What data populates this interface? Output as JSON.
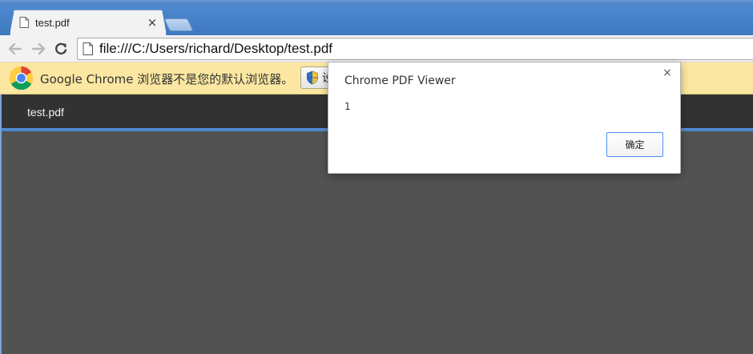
{
  "tab": {
    "title": "test.pdf",
    "close_glyph": "×",
    "icon": "page-icon"
  },
  "toolbar": {
    "back_icon": "back-arrow-icon",
    "forward_icon": "forward-arrow-icon",
    "reload_icon": "reload-icon",
    "url": "file:///C:/Users/richard/Desktop/test.pdf"
  },
  "infobar": {
    "logo_icon": "chrome-logo-icon",
    "message": "Google Chrome 浏览器不是您的默认浏览器。",
    "button_label": "设"
  },
  "pdf_viewer": {
    "title": "test.pdf"
  },
  "dialog": {
    "title": "Chrome PDF Viewer",
    "message": "1",
    "close_glyph": "×",
    "ok_label": "确定"
  },
  "colors": {
    "tab_strip": "#4a86c8",
    "infobar_bg": "#fbe7a1",
    "pdf_toolbar": "#323232",
    "pdf_canvas": "#525252",
    "focus_blue": "#4d90fe"
  }
}
